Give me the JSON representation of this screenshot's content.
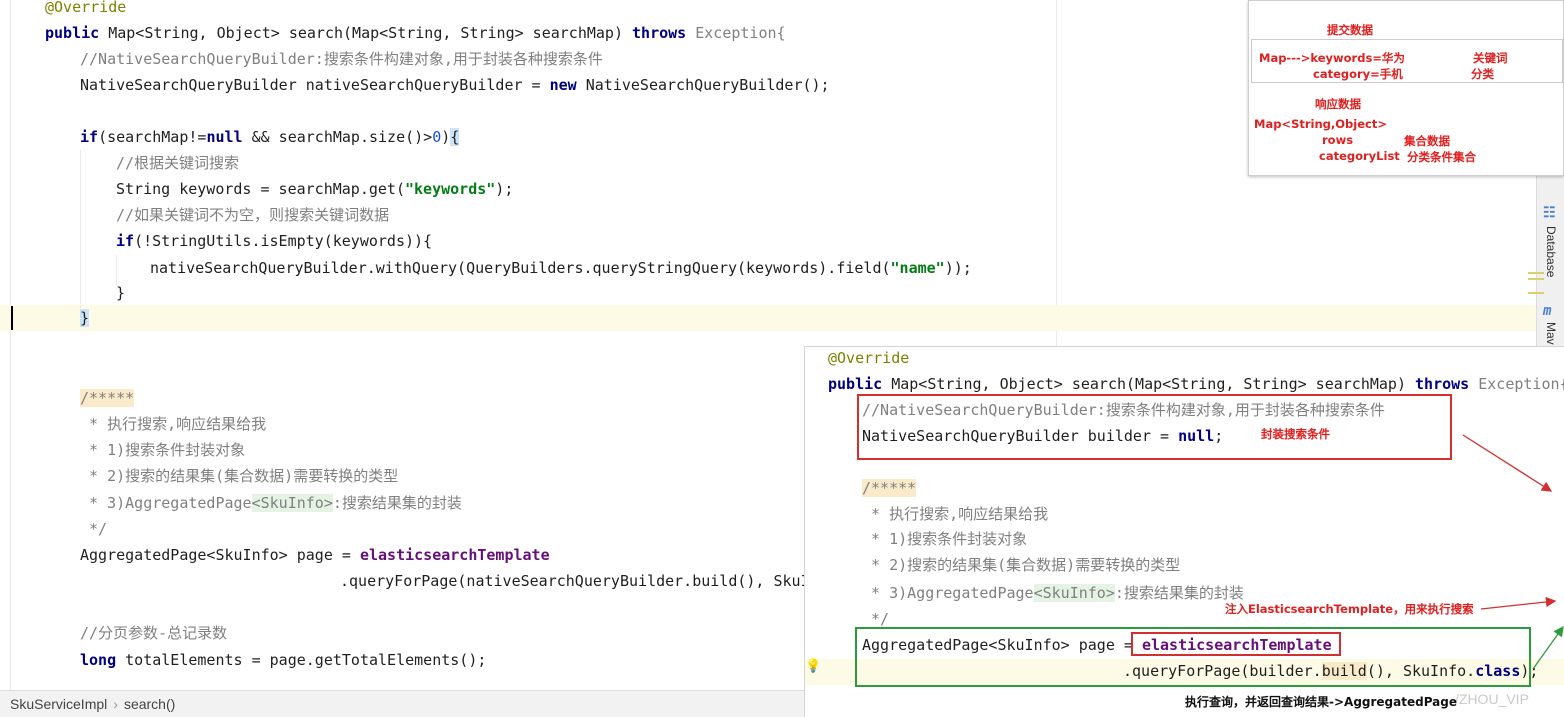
{
  "editor": {
    "lines": {
      "l1_ann": "@Override",
      "l2_public": "public",
      "l2_sig": " Map<String, Object> search(Map<String, String> searchMap) ",
      "l2_throws": "throws",
      "l2_exc": " Exception{",
      "l3_comment": "//NativeSearchQueryBuilder:搜索条件构建对象,用于封装各种搜索条件",
      "l4_a": "NativeSearchQueryBuilder nativeSearchQueryBuilder = ",
      "l4_new": "new",
      "l4_b": " NativeSearchQueryBuilder();",
      "l6_if": "if",
      "l6_a": "(searchMap!=",
      "l6_null": "null",
      "l6_b": " && searchMap.size()>",
      "l6_zero": "0",
      "l6_c": ")",
      "l6_brace": "{",
      "l7_comment": "//根据关键词搜索",
      "l8_a": "String keywords = searchMap.get(",
      "l8_str": "\"keywords\"",
      "l8_b": ");",
      "l9_comment": "//如果关键词不为空，则搜索关键词数据",
      "l10_if": "if",
      "l10_rest": "(!StringUtils.isEmpty(keywords)){",
      "l11_a": "nativeSearchQueryBuilder.withQuery(QueryBuilders.queryStringQuery(keywords).field(",
      "l11_str": "\"name\"",
      "l11_b": "));",
      "l12": "}",
      "l13": "}",
      "doc_open": "/*****",
      "doc1": " * 执行搜索,响应结果给我",
      "doc2": " * 1)搜索条件封装对象",
      "doc3": " * 2)搜索的结果集(集合数据)需要转换的类型",
      "doc4_a": " * 3)AggregatedPage",
      "doc4_hl": "<SkuInfo>",
      "doc4_b": ":搜索结果集的封装",
      "doc_close": " */",
      "page_a": "AggregatedPage<SkuInfo> page = ",
      "page_fld": "elasticsearchTemplate",
      "query_line": ".queryForPage(nativeSearchQueryBuilder.build(), SkuIn",
      "page_comment": "//分页参数-总记录数",
      "long_kw": "long",
      "long_rest": " totalElements = page.getTotalElements();"
    }
  },
  "status_bar": {
    "class_name": "SkuServiceImpl",
    "separator": "›",
    "method": "search()"
  },
  "right_strip": {
    "database_tab": "Database",
    "maven_tab": "Mav"
  },
  "note_panel": {
    "submit_title": "提交数据",
    "map_keywords": "Map--->keywords=华为",
    "keyword_label": "关键词",
    "category": "category=手机",
    "category_label": "分类",
    "response_title": "响应数据",
    "map_type": "Map<String,Object>",
    "rows": "rows",
    "rows_label": "集合数据",
    "category_list": "categoryList",
    "category_list_label": "分类条件集合"
  },
  "overlay": {
    "ann": "@Override",
    "public": "public",
    "sig": " Map<String, Object> search(Map<String, String> searchMap) ",
    "throws": "throws",
    "exc": " Exception{",
    "comment": "//NativeSearchQueryBuilder:搜索条件构建对象,用于封装各种搜索条件",
    "builder_a": "NativeSearchQueryBuilder builder = ",
    "builder_null": "null",
    "builder_b": ";",
    "builder_label": "封装搜索条件",
    "doc_open": "/*****",
    "doc1": " * 执行搜索,响应结果给我",
    "doc2": " * 1)搜索条件封装对象",
    "doc3": " * 2)搜索的结果集(集合数据)需要转换的类型",
    "doc4_a": " * 3)AggregatedPage",
    "doc4_hl": "<SkuInfo>",
    "doc4_b": ":搜索结果集的封装",
    "doc_close": " */",
    "inject_label": "注入ElasticsearchTemplate，用来执行搜索",
    "page_a": "AggregatedPage<SkuInfo> page = ",
    "page_fld": "elasticsearchTemplate",
    "query_a": ".queryForPage(builder.",
    "query_build": "build",
    "query_b": "(), SkuInfo.",
    "query_class": "class",
    "query_c": ");",
    "caption": "执行查询，并返回查询结果->AggregatedPage",
    "watermark": "/ZHOU_VIP"
  },
  "colors": {
    "annotation_red": "#e0201f",
    "box_red": "#d32f2f",
    "box_green": "#2e9a3e",
    "keyword": "#000080",
    "string": "#067d17",
    "comment": "#808080"
  }
}
